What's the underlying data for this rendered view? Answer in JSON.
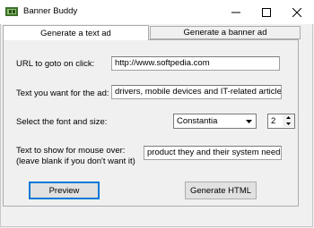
{
  "window": {
    "title": "Banner Buddy"
  },
  "tabs": [
    {
      "label": "Generate a text ad",
      "active": true
    },
    {
      "label": "Generate a banner ad",
      "active": false
    }
  ],
  "form": {
    "url_label": "URL to goto on click:",
    "url_value": "http://www.softpedia.com",
    "text_label": "Text you want for the ad:",
    "text_value": "drivers, mobile devices and IT-related articles.",
    "font_label": "Select the font and size:",
    "font_value": "Constantia",
    "size_value": "2",
    "mouseover_label_1": "Text to show for mouse over:",
    "mouseover_label_2": "(leave blank if you don't want it)",
    "mouseover_value": "product they and their system needs."
  },
  "buttons": {
    "preview": "Preview",
    "generate": "Generate HTML"
  },
  "colors": {
    "focus": "#0078d7",
    "window_bg": "#f0f0f0"
  }
}
